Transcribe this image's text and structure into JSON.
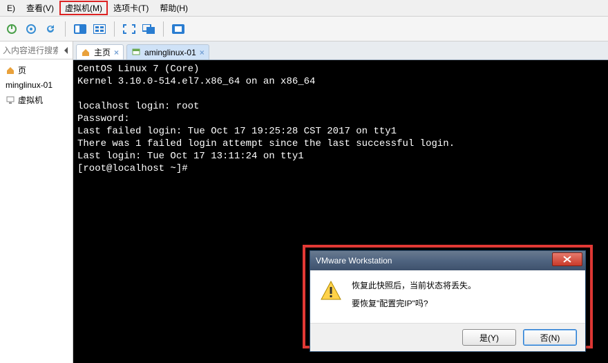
{
  "menubar": {
    "edit": "E)",
    "view": "查看(V)",
    "vm": "虚拟机(M)",
    "tabs": "选项卡(T)",
    "help": "帮助(H)"
  },
  "sidebar": {
    "search_placeholder": "入内容进行搜索",
    "tree": {
      "root": "页",
      "vm": "minglinux-01",
      "computer": "虚拟机"
    }
  },
  "tabs": {
    "home": "主页",
    "vm": "aminglinux-01"
  },
  "terminal": "CentOS Linux 7 (Core)\nKernel 3.10.0-514.el7.x86_64 on an x86_64\n\nlocalhost login: root\nPassword:\nLast failed login: Tue Oct 17 19:25:28 CST 2017 on tty1\nThere was 1 failed login attempt since the last successful login.\nLast login: Tue Oct 17 13:11:24 on tty1\n[root@localhost ~]#",
  "dialog": {
    "title": "VMware Workstation",
    "line1": "恢复此快照后，当前状态将丢失。",
    "line2": "要恢复\"配置完IP\"吗?",
    "yes": "是(Y)",
    "no": "否(N)"
  }
}
